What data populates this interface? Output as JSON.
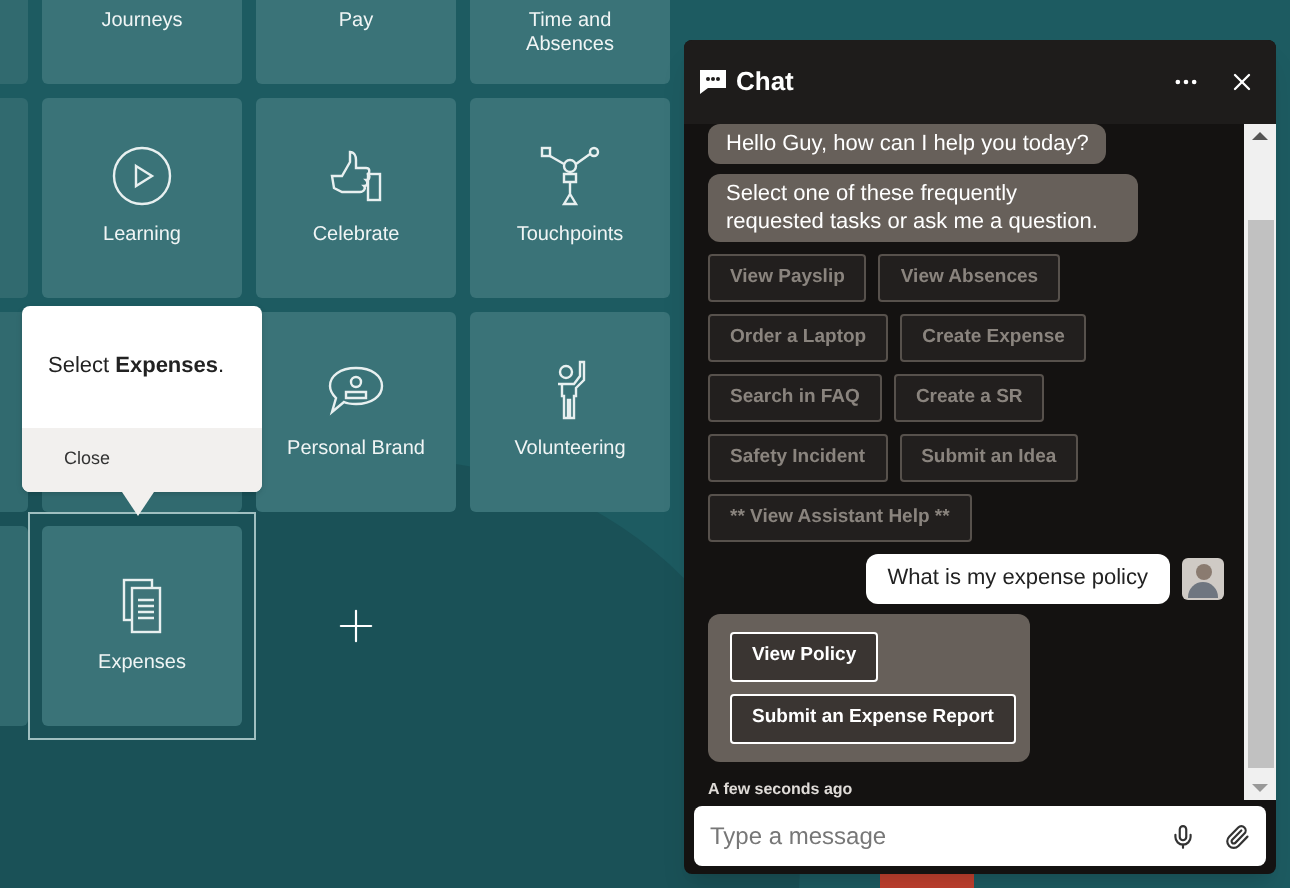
{
  "tile_rows": [
    {
      "tiles": [
        {
          "kind": "app",
          "label": "Journeys",
          "selected": false
        },
        {
          "kind": "app",
          "label": "Pay",
          "selected": false
        },
        {
          "kind": "app",
          "label": "Time and Absences",
          "selected": false
        }
      ]
    },
    {
      "tiles": [
        {
          "kind": "app",
          "label": "Learning",
          "selected": false
        },
        {
          "kind": "app",
          "label": "Celebrate",
          "selected": false
        },
        {
          "kind": "app",
          "label": "Touchpoints",
          "selected": false
        }
      ]
    },
    {
      "tiles": [
        {
          "kind": "app",
          "label": "Personal Brand",
          "selected": false
        },
        {
          "kind": "app",
          "label": "Volunteering",
          "selected": false
        }
      ]
    },
    {
      "tiles": [
        {
          "kind": "app",
          "label": "Expenses",
          "selected": true
        },
        {
          "kind": "add"
        }
      ]
    }
  ],
  "popover": {
    "text": "Select **Expenses**.",
    "close": "Close"
  },
  "chat": {
    "title": "Chat",
    "messages": [
      {
        "kind": "bot",
        "text": "Hello Guy, how can I help you today?"
      },
      {
        "kind": "bot",
        "text": "Select one of these frequently requested tasks or ask me a question."
      },
      {
        "kind": "chips",
        "buttons": [
          "View Payslip",
          "View Absences",
          "Order a Laptop",
          "Create Expense",
          "Search in FAQ",
          "Create a SR",
          "Safety Incident",
          "Submit an Idea",
          "** View Assistant Help **"
        ]
      },
      {
        "kind": "user",
        "text": "What is my expense policy"
      },
      {
        "kind": "card",
        "buttons": [
          "View Policy",
          "Submit an Expense Report"
        ]
      },
      {
        "kind": "time",
        "text": "A few seconds ago"
      }
    ],
    "input": {
      "placeholder": "Type a message"
    }
  }
}
